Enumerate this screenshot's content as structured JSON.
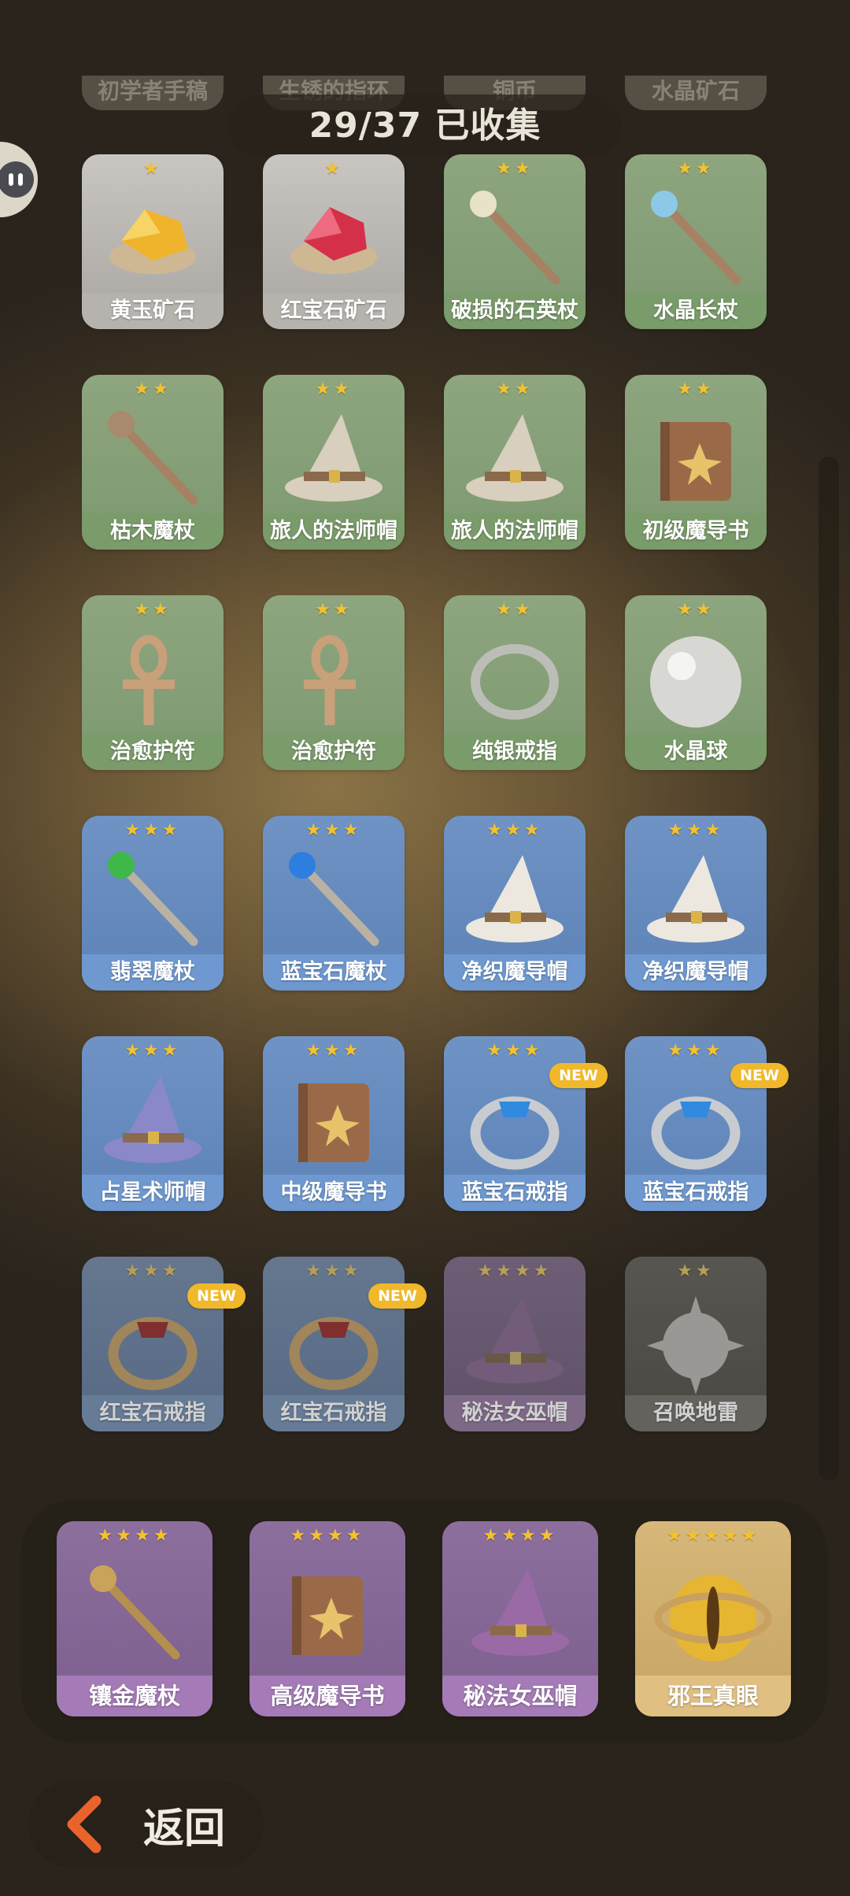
{
  "counter": {
    "text": "29/37 已收集"
  },
  "ghost_items": [
    "初学者手稿",
    "生锈的指环",
    "铜币",
    "水晶矿石"
  ],
  "grid": [
    {
      "label": "黄玉矿石",
      "stars": "★",
      "rarity": 1,
      "icon": "topaz-ore-icon",
      "dim": false,
      "is_new": false
    },
    {
      "label": "红宝石矿石",
      "stars": "★",
      "rarity": 1,
      "icon": "ruby-ore-icon",
      "dim": false,
      "is_new": false
    },
    {
      "label": "破损的石英杖",
      "stars": "★★",
      "rarity": 2,
      "icon": "quartz-staff-icon",
      "dim": false,
      "is_new": false
    },
    {
      "label": "水晶长杖",
      "stars": "★★",
      "rarity": 2,
      "icon": "crystal-staff-icon",
      "dim": false,
      "is_new": false
    },
    {
      "label": "枯木魔杖",
      "stars": "★★",
      "rarity": 2,
      "icon": "wooden-wand-icon",
      "dim": false,
      "is_new": false
    },
    {
      "label": "旅人的法师帽",
      "stars": "★★",
      "rarity": 2,
      "icon": "wizard-hat-icon",
      "dim": false,
      "is_new": false
    },
    {
      "label": "旅人的法师帽",
      "stars": "★★",
      "rarity": 2,
      "icon": "wizard-hat-icon",
      "dim": false,
      "is_new": false
    },
    {
      "label": "初级魔导书",
      "stars": "★★",
      "rarity": 2,
      "icon": "spellbook-icon",
      "dim": false,
      "is_new": false
    },
    {
      "label": "治愈护符",
      "stars": "★★",
      "rarity": 2,
      "icon": "ankh-amulet-icon",
      "dim": false,
      "is_new": false
    },
    {
      "label": "治愈护符",
      "stars": "★★",
      "rarity": 2,
      "icon": "ankh-amulet-icon",
      "dim": false,
      "is_new": false
    },
    {
      "label": "纯银戒指",
      "stars": "★★",
      "rarity": 2,
      "icon": "silver-ring-icon",
      "dim": false,
      "is_new": false
    },
    {
      "label": "水晶球",
      "stars": "★★",
      "rarity": 2,
      "icon": "crystal-ball-icon",
      "dim": false,
      "is_new": false
    },
    {
      "label": "翡翠魔杖",
      "stars": "★★★",
      "rarity": 3,
      "icon": "emerald-wand-icon",
      "dim": false,
      "is_new": false
    },
    {
      "label": "蓝宝石魔杖",
      "stars": "★★★",
      "rarity": 3,
      "icon": "sapphire-wand-icon",
      "dim": false,
      "is_new": false
    },
    {
      "label": "净织魔导帽",
      "stars": "★★★",
      "rarity": 3,
      "icon": "white-hat-icon",
      "dim": false,
      "is_new": false
    },
    {
      "label": "净织魔导帽",
      "stars": "★★★",
      "rarity": 3,
      "icon": "white-hat-icon",
      "dim": false,
      "is_new": false
    },
    {
      "label": "占星术师帽",
      "stars": "★★★",
      "rarity": 3,
      "icon": "astrologer-hat-icon",
      "dim": false,
      "is_new": false
    },
    {
      "label": "中级魔导书",
      "stars": "★★★",
      "rarity": 3,
      "icon": "spellbook-icon",
      "dim": false,
      "is_new": false
    },
    {
      "label": "蓝宝石戒指",
      "stars": "★★★",
      "rarity": 3,
      "icon": "sapphire-ring-icon",
      "dim": false,
      "is_new": true
    },
    {
      "label": "蓝宝石戒指",
      "stars": "★★★",
      "rarity": 3,
      "icon": "sapphire-ring-icon",
      "dim": false,
      "is_new": true
    },
    {
      "label": "红宝石戒指",
      "stars": "★★★",
      "rarity": 3,
      "icon": "ruby-ring-icon",
      "dim": true,
      "is_new": true
    },
    {
      "label": "红宝石戒指",
      "stars": "★★★",
      "rarity": 3,
      "icon": "ruby-ring-icon",
      "dim": true,
      "is_new": true
    },
    {
      "label": "秘法女巫帽",
      "stars": "★★★★",
      "rarity": 4,
      "icon": "witch-hat-icon",
      "dim": true,
      "is_new": false
    },
    {
      "label": "召唤地雷",
      "stars": "★★",
      "rarity": 2,
      "icon": "spiked-mine-icon",
      "dim": true,
      "is_new": false
    }
  ],
  "badge_text": "NEW",
  "tray": [
    {
      "label": "镶金魔杖",
      "stars": "★★★★",
      "rarity": 4,
      "icon": "gilded-wand-icon"
    },
    {
      "label": "高级魔导书",
      "stars": "★★★★",
      "rarity": 4,
      "icon": "pentagram-book-icon"
    },
    {
      "label": "秘法女巫帽",
      "stars": "★★★★",
      "rarity": 4,
      "icon": "witch-hat-icon"
    },
    {
      "label": "邪王真眼",
      "stars": "★★★★★",
      "rarity": 5,
      "icon": "evil-eye-orb-icon"
    }
  ],
  "back": {
    "label": "返回",
    "icon": "chevron-left-icon"
  },
  "colors": {
    "accent_orange": "#e8642b",
    "star_gold": "#f2c230",
    "new_badge": "#f0b82a"
  }
}
